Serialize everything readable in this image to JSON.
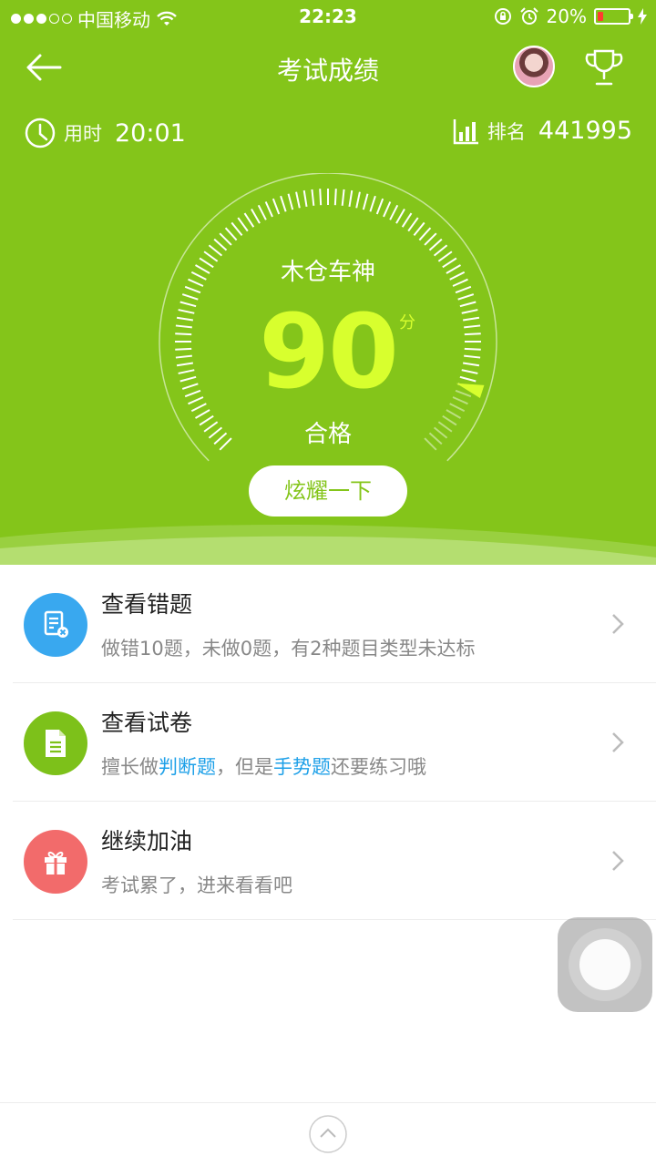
{
  "status_bar": {
    "carrier": "中国移动",
    "time": "22:23",
    "battery_percent": "20%",
    "battery_level": 0.2,
    "signal_bars_filled": 3,
    "signal_bars_total": 5
  },
  "nav": {
    "title": "考试成绩",
    "back_icon": "arrow-left-icon",
    "trophy_icon": "trophy-icon"
  },
  "stats": {
    "time_label": "用时",
    "time_value": "20:01",
    "rank_label": "排名",
    "rank_value": "441995"
  },
  "result": {
    "title": "木仓车神",
    "score": "90",
    "unit": "分",
    "status": "合格",
    "score_fraction": 0.9
  },
  "share_button": "炫耀一下",
  "list": {
    "items": [
      {
        "title": "查看错题",
        "desc": "做错10题，未做0题，有2种题目类型未达标",
        "icon": "wrong-questions-icon",
        "color": "#39a8ef"
      },
      {
        "title": "查看试卷",
        "desc_parts": [
          "擅长做",
          "判断题",
          "，但是",
          "手势题",
          "还要练习哦"
        ],
        "icon": "document-icon",
        "color": "#7dc11a"
      },
      {
        "title": "继续加油",
        "desc": "考试累了，进来看看吧",
        "icon": "gift-icon",
        "color": "#f26b6b"
      }
    ]
  },
  "colors": {
    "primary_green": "#84c51a",
    "score_yellow": "#d8ff2e",
    "highlight_blue": "#1ea0e8"
  }
}
